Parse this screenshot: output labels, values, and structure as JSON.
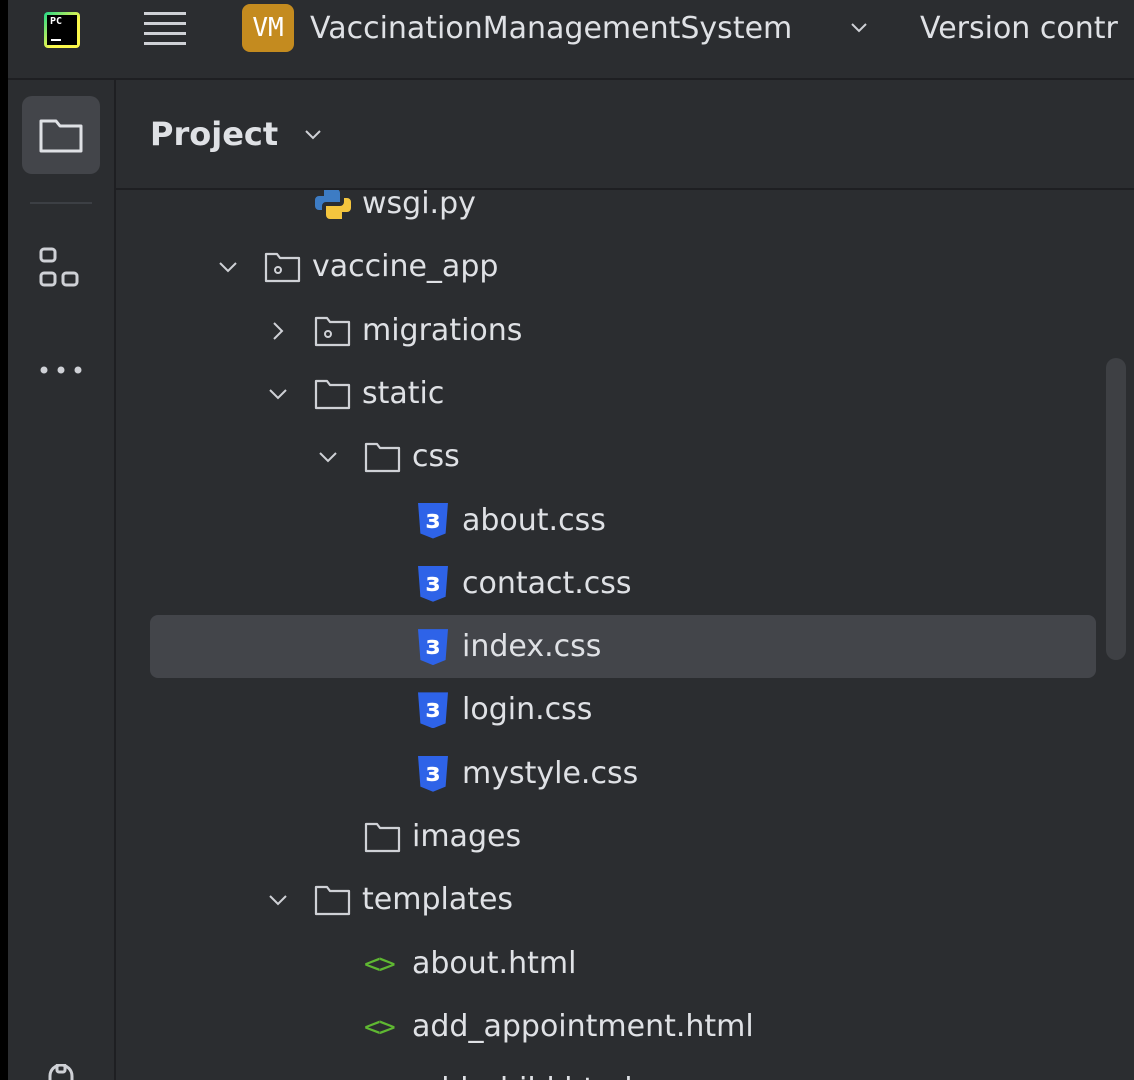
{
  "topbar": {
    "app_logo_text": "PC",
    "project_badge": "VM",
    "project_name": "VaccinationManagementSystem",
    "vcs_menu_label": "Version contr"
  },
  "panel": {
    "title": "Project"
  },
  "tree": [
    {
      "label": "wsgi.py",
      "type": "python",
      "depth": 2,
      "expandable": false
    },
    {
      "label": "vaccine_app",
      "type": "package",
      "depth": 1,
      "expandable": true,
      "expanded": true
    },
    {
      "label": "migrations",
      "type": "package",
      "depth": 2,
      "expandable": true,
      "expanded": false
    },
    {
      "label": "static",
      "type": "folder",
      "depth": 2,
      "expandable": true,
      "expanded": true
    },
    {
      "label": "css",
      "type": "folder",
      "depth": 3,
      "expandable": true,
      "expanded": true
    },
    {
      "label": "about.css",
      "type": "css",
      "depth": 4,
      "expandable": false
    },
    {
      "label": "contact.css",
      "type": "css",
      "depth": 4,
      "expandable": false
    },
    {
      "label": "index.css",
      "type": "css",
      "depth": 4,
      "expandable": false,
      "selected": true
    },
    {
      "label": "login.css",
      "type": "css",
      "depth": 4,
      "expandable": false
    },
    {
      "label": "mystyle.css",
      "type": "css",
      "depth": 4,
      "expandable": false
    },
    {
      "label": "images",
      "type": "folder",
      "depth": 3,
      "expandable": false
    },
    {
      "label": "templates",
      "type": "folder",
      "depth": 2,
      "expandable": true,
      "expanded": true
    },
    {
      "label": "about.html",
      "type": "html",
      "depth": 3,
      "expandable": false
    },
    {
      "label": "add_appointment.html",
      "type": "html",
      "depth": 3,
      "expandable": false
    },
    {
      "label": "add_child.html",
      "type": "html",
      "depth": 3,
      "expandable": false
    }
  ],
  "colors": {
    "background": "#2b2d30",
    "selection": "#43454a",
    "text": "#dfe1e5",
    "css_icon": "#2e63e8",
    "html_icon": "#5fb832",
    "badge": "#c48b1f"
  }
}
